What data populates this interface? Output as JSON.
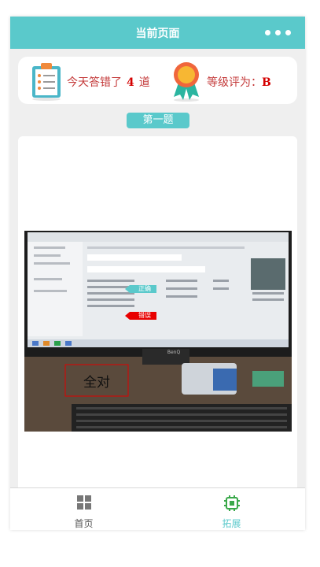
{
  "header": {
    "title": "当前页面",
    "more_icon": "ellipsis-icon"
  },
  "stats": {
    "wrong_prefix": "今天答错了",
    "wrong_count": "4",
    "wrong_suffix": "道",
    "grade_label": "等级评为：",
    "grade_value": "B",
    "left_icon": "clipboard-checklist-icon",
    "right_icon": "award-medal-icon"
  },
  "question": {
    "badge": "第一题"
  },
  "photo": {
    "tag_correct": "正确",
    "tag_wrong": "错误",
    "answer_box": "全对",
    "monitor_brand": "BenQ"
  },
  "tabbar": {
    "items": [
      {
        "label": "首页",
        "icon": "grid-icon",
        "active": false
      },
      {
        "label": "拓展",
        "icon": "chip-icon",
        "active": true
      }
    ]
  },
  "colors": {
    "accent": "#5ac9cb",
    "highlight": "#d40000",
    "text_red": "#c43a3a"
  }
}
